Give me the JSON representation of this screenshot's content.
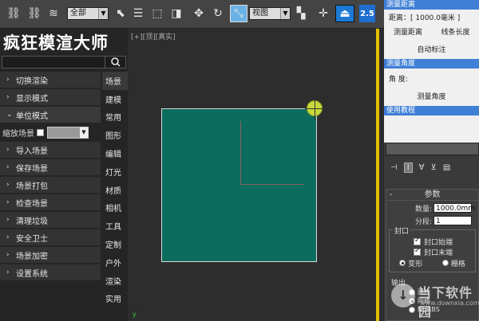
{
  "toolbar": {
    "icons": [
      "link-icon",
      "unlink-icon",
      "bind-space-warp-icon",
      "select-object-icon",
      "select-by-name-icon",
      "rect-select-icon",
      "window-crossing-icon",
      "move-icon",
      "rotate-icon",
      "scale-icon",
      "ref-coord-icon",
      "pivot-icon",
      "manipulate-icon",
      "snap-icon"
    ],
    "filter_label": "全部",
    "ref_coord_label": "视图",
    "snap_value": "2.5",
    "accent": "#1c79d6"
  },
  "left_panel": {
    "brand": "疯狂模渲大师",
    "menu": [
      {
        "label": "切换渲染",
        "open": false
      },
      {
        "label": "显示模式",
        "open": false
      },
      {
        "label": "单位模式",
        "open": true
      },
      {
        "label": "导入场景",
        "open": false
      },
      {
        "label": "保存场景",
        "open": false
      },
      {
        "label": "场景打包",
        "open": false
      },
      {
        "label": "检查场景",
        "open": false
      },
      {
        "label": "清理垃圾",
        "open": false
      },
      {
        "label": "安全卫士",
        "open": false
      },
      {
        "label": "场景加密",
        "open": false
      },
      {
        "label": "设置系统",
        "open": false
      }
    ],
    "scale_label": "缩放场景",
    "tabs": [
      "场景",
      "建模",
      "常用",
      "图形",
      "编辑",
      "灯光",
      "材质",
      "相机",
      "工具",
      "定制",
      "户外",
      "渲染",
      "实用"
    ]
  },
  "viewport": {
    "label": "[+][顶][真实]",
    "axis": "y",
    "plane_color": "#0c6c5e"
  },
  "measure": {
    "distance_header": "测量距离",
    "distance_text": "距离：[ 1000.0毫米 ]",
    "measure_distance_btn": "测量距离",
    "line_length_btn": "线条长度",
    "auto_dim_btn": "自动标注",
    "angle_header": "测量角度",
    "angle_text": "角 度:",
    "measure_angle_btn": "测量角度",
    "tutorial_header": "使用教程"
  },
  "command_panel": {
    "params_title": "参数",
    "count_label": "数量:",
    "count_value": "1000.0mm",
    "segments_label": "分段:",
    "segments_value": "1",
    "cap_group": "封口",
    "cap_start": "封口始端",
    "cap_end": "封口末端",
    "morph": "变形",
    "grid": "栅格",
    "output_label": "输出",
    "out_patch": "面片",
    "out_mesh": "网格",
    "out_nurbs": "NURBS"
  },
  "watermark": {
    "logo": "当下软件园",
    "url": "www.downxia.com"
  }
}
